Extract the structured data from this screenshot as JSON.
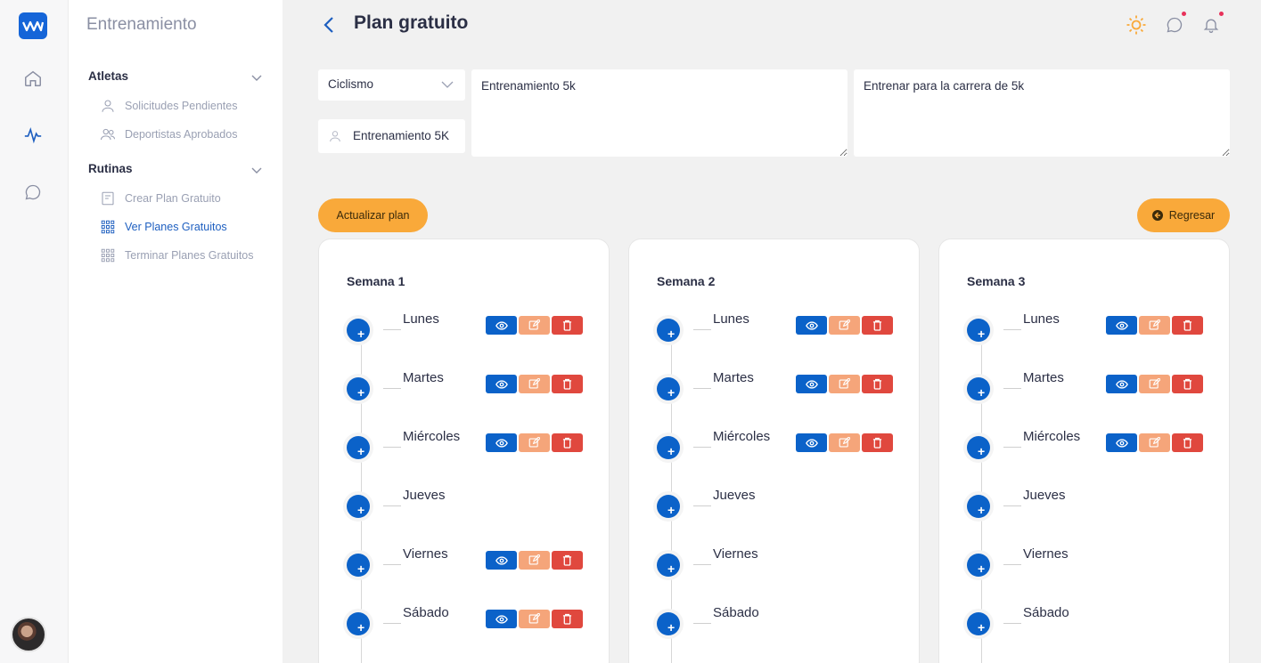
{
  "colors": {
    "primary": "#0b62c9",
    "accent": "#f9a93a",
    "danger": "#e0483e",
    "edit": "#f5a57a",
    "notification": "#e8315a"
  },
  "rail": {
    "items": [
      "home-icon",
      "activity-icon",
      "chat-icon"
    ]
  },
  "sidebar": {
    "title": "Entrenamiento",
    "groups": [
      {
        "label": "Atletas",
        "items": [
          {
            "label": "Solicitudes Pendientes",
            "icon": "user-icon"
          },
          {
            "label": "Deportistas Aprobados",
            "icon": "users-icon"
          }
        ]
      },
      {
        "label": "Rutinas",
        "items": [
          {
            "label": "Crear Plan Gratuito",
            "icon": "plan-icon"
          },
          {
            "label": "Ver Planes Gratuitos",
            "icon": "grid-icon",
            "active": true
          },
          {
            "label": "Terminar Planes Gratuitos",
            "icon": "grid-icon"
          }
        ]
      }
    ]
  },
  "header": {
    "title": "Plan gratuito"
  },
  "form": {
    "sport_value": "Ciclismo",
    "plan_name": "Entrenamiento 5K",
    "description": "Entrenamiento 5k",
    "goal": "Entrenar para la carrera de 5k"
  },
  "buttons": {
    "update": "Actualizar plan",
    "back": "Regresar"
  },
  "weeks": [
    {
      "title": "Semana 1",
      "days": [
        {
          "name": "Lunes",
          "has_actions": true
        },
        {
          "name": "Martes",
          "has_actions": true
        },
        {
          "name": "Miércoles",
          "has_actions": true
        },
        {
          "name": "Jueves",
          "has_actions": false
        },
        {
          "name": "Viernes",
          "has_actions": true
        },
        {
          "name": "Sábado",
          "has_actions": true
        }
      ]
    },
    {
      "title": "Semana 2",
      "days": [
        {
          "name": "Lunes",
          "has_actions": true
        },
        {
          "name": "Martes",
          "has_actions": true
        },
        {
          "name": "Miércoles",
          "has_actions": true
        },
        {
          "name": "Jueves",
          "has_actions": false
        },
        {
          "name": "Viernes",
          "has_actions": false
        },
        {
          "name": "Sábado",
          "has_actions": false
        }
      ]
    },
    {
      "title": "Semana 3",
      "days": [
        {
          "name": "Lunes",
          "has_actions": true
        },
        {
          "name": "Martes",
          "has_actions": true
        },
        {
          "name": "Miércoles",
          "has_actions": true
        },
        {
          "name": "Jueves",
          "has_actions": false
        },
        {
          "name": "Viernes",
          "has_actions": false
        },
        {
          "name": "Sábado",
          "has_actions": false
        }
      ]
    }
  ]
}
